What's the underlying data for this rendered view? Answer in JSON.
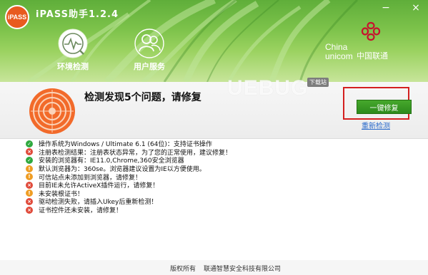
{
  "app": {
    "title": "iPASS助手1.2.4",
    "logo_text": "iPASS"
  },
  "window_controls": {
    "minimize": "−",
    "close": "×"
  },
  "nav": [
    {
      "label": "环境检测",
      "icon": "stethoscope-icon",
      "active": true
    },
    {
      "label": "用户服务",
      "icon": "users-icon",
      "active": false
    }
  ],
  "brand": {
    "en_line1": "China",
    "en_line2": "unicom",
    "cn": "中国联通"
  },
  "result": {
    "summary": "检测发现5个问题，请修复",
    "fix_button": "一键修复",
    "recheck_link": "重新检测"
  },
  "watermark": {
    "text": "UEBUG",
    "tag": "下载站"
  },
  "issues": [
    {
      "status": "ok",
      "text": "操作系统为Windows / Ultimate 6.1 (64位)：支持证书操作"
    },
    {
      "status": "error",
      "text": "注册表检测结果：注册表状态异常，为了您的正常使用，建议修复！"
    },
    {
      "status": "ok",
      "text": "安装的浏览器有：IE11.0,Chrome,360安全浏览器"
    },
    {
      "status": "warn",
      "text": "默认浏览器为：360se。浏览器建议设置为IE以方便使用。"
    },
    {
      "status": "warn",
      "text": "可信站点未添加到浏览器，请修复！"
    },
    {
      "status": "error",
      "text": "目前IE未允许ActiveX插件运行，请修复！"
    },
    {
      "status": "warn",
      "text": "未安装根证书！"
    },
    {
      "status": "error",
      "text": "驱动检测失败，请插入Ukey后重新检测！"
    },
    {
      "status": "error",
      "text": "证书控件还未安装，请修复！"
    }
  ],
  "status_glyphs": {
    "ok": "✓",
    "error": "×",
    "warn": "!"
  },
  "footer": {
    "left": "版权所有",
    "right": "联通智慧安全科技有限公司"
  },
  "colors": {
    "header_green": "#7cc24a",
    "accent_orange": "#e85a1f",
    "fix_button": "#3a9a24",
    "highlight_box": "#d42020",
    "ok": "#2fa93f",
    "error": "#e04a3a",
    "warn": "#ef9d24"
  }
}
